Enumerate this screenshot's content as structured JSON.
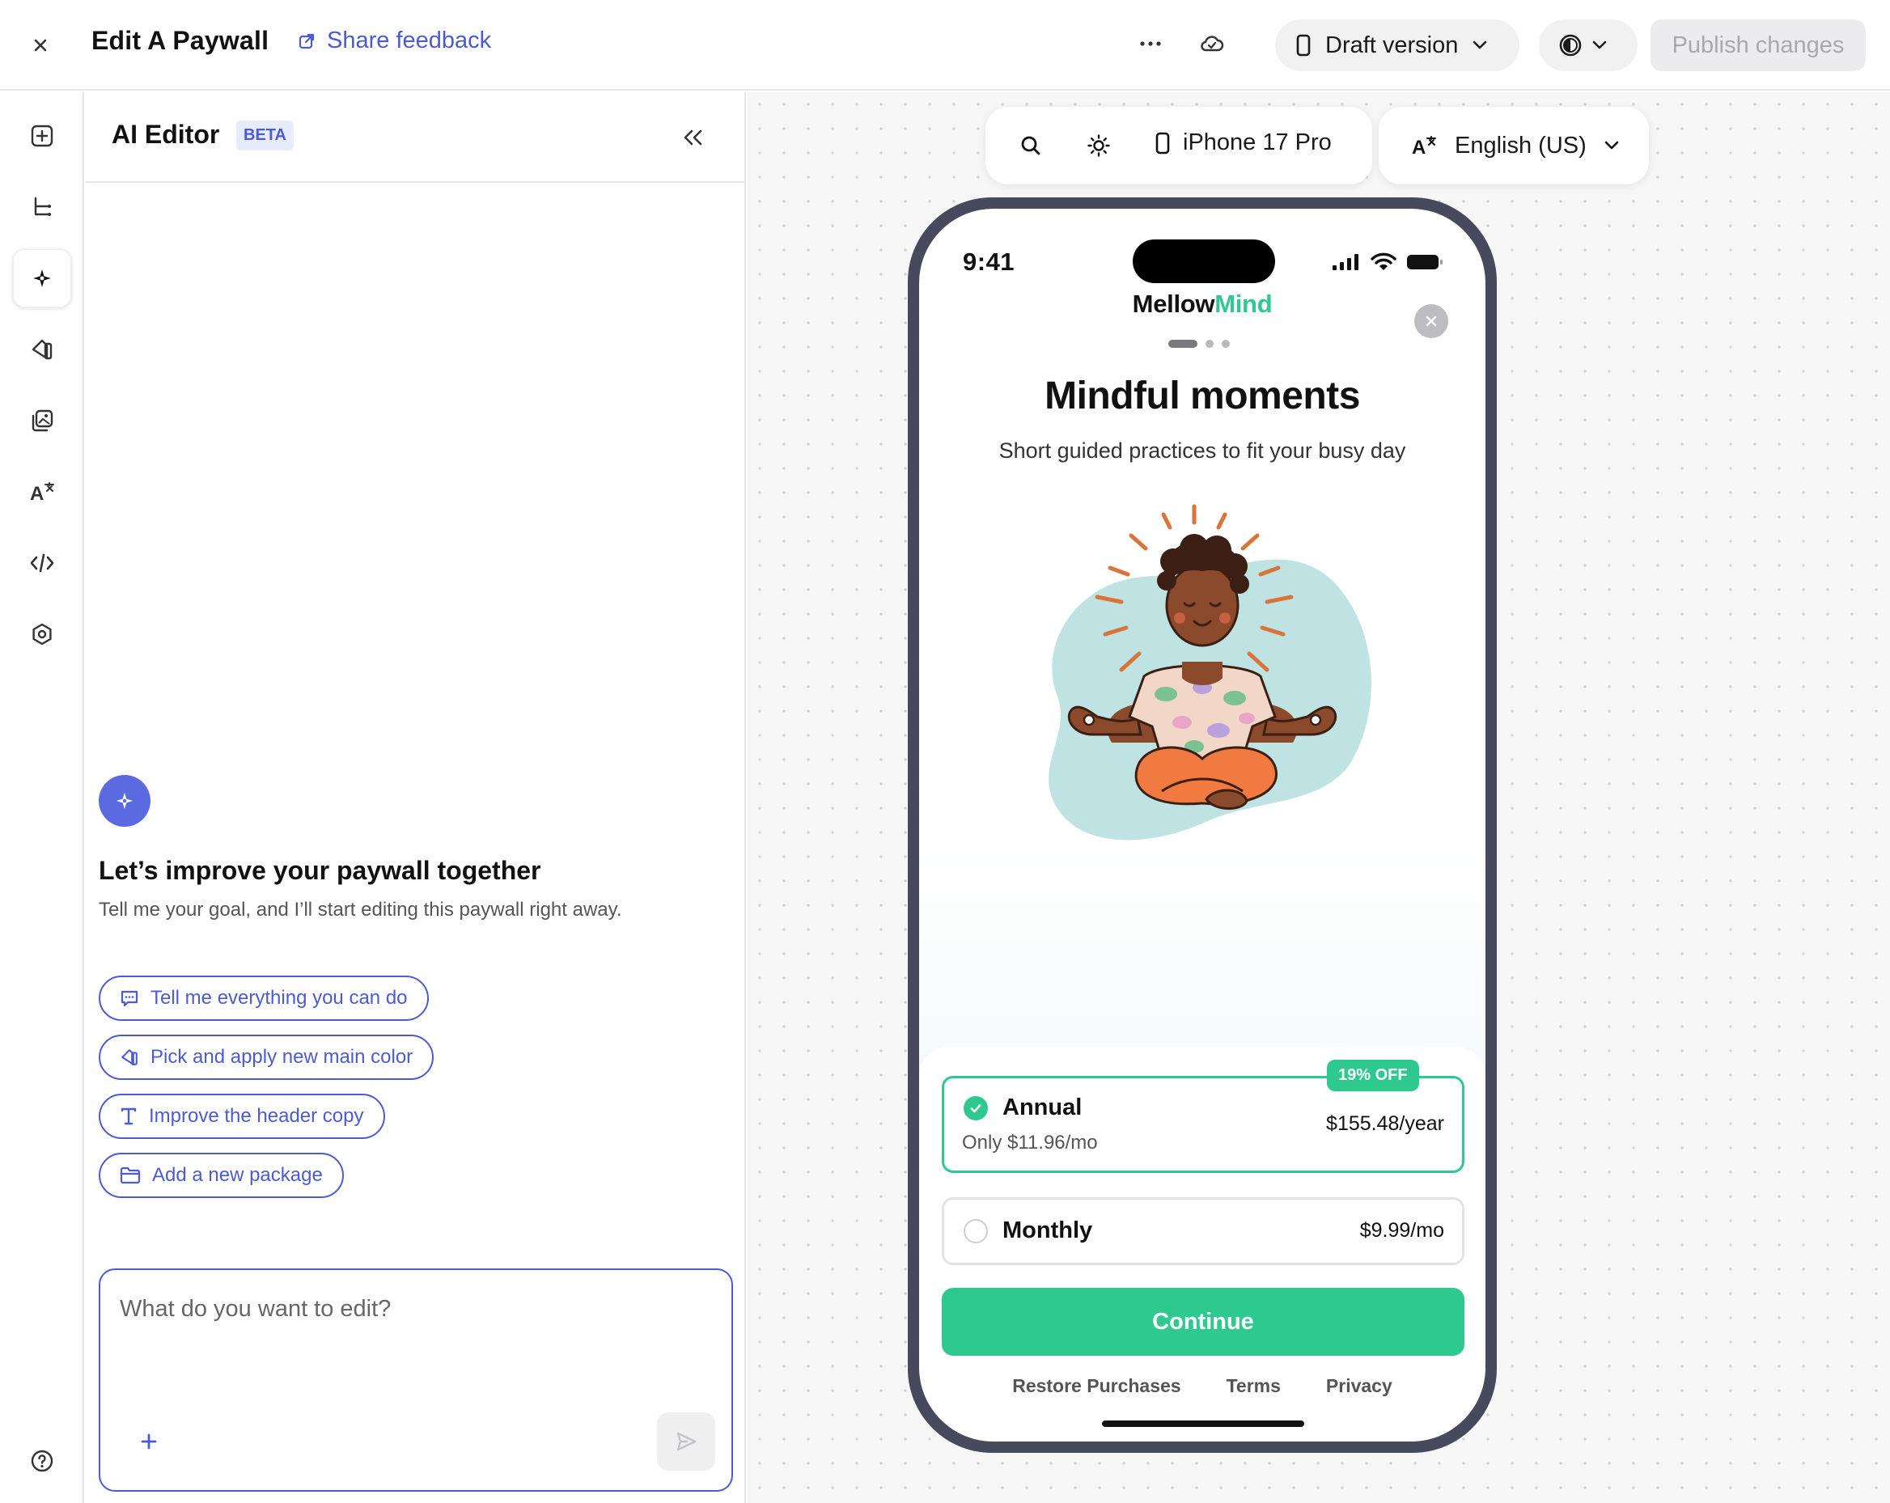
{
  "header": {
    "title": "Edit A Paywall",
    "share_feedback": "Share feedback",
    "version_label": "Draft version",
    "publish_label": "Publish changes"
  },
  "ai_panel": {
    "title": "AI Editor",
    "badge": "BETA",
    "intro_title": "Let’s improve your paywall together",
    "intro_subtitle": "Tell me your goal, and I’ll start editing this paywall right away.",
    "suggestions": [
      {
        "label": "Tell me everything you can do",
        "icon": "chat-icon"
      },
      {
        "label": "Pick and apply new main color",
        "icon": "paint-bucket-icon"
      },
      {
        "label": "Improve the header copy",
        "icon": "text-icon"
      },
      {
        "label": "Add a new package",
        "icon": "folder-icon"
      }
    ],
    "input_placeholder": "What do you want to edit?"
  },
  "canvas_toolbar": {
    "device": "iPhone 17 Pro",
    "language": "English (US)"
  },
  "phone": {
    "time": "9:41",
    "brand_part1": "Mellow",
    "brand_part2": "Mind",
    "headline": "Mindful moments",
    "subheadline": "Short guided practices to fit your busy day",
    "plans": [
      {
        "name": "Annual",
        "subtitle": "Only $11.96/mo",
        "price": "$155.48/year",
        "badge": "19% OFF",
        "selected": true
      },
      {
        "name": "Monthly",
        "price": "$9.99/mo",
        "selected": false
      }
    ],
    "cta": "Continue",
    "footer_links": [
      "Restore Purchases",
      "Terms",
      "Privacy"
    ]
  },
  "colors": {
    "accent": "#4b5bd6",
    "brand_green": "#2ec98f",
    "phone_frame": "#474a5c"
  }
}
